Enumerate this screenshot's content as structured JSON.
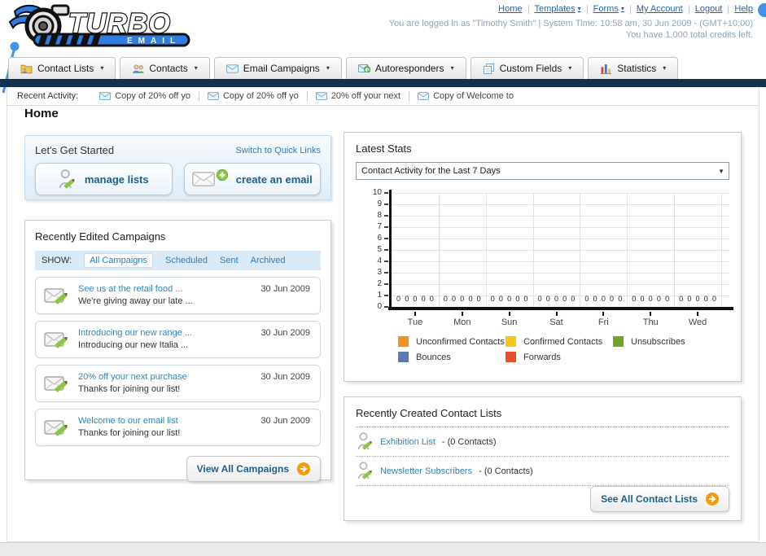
{
  "page_title": "Home",
  "icons": {
    "caret_down": "▾",
    "select_arrow": "▼"
  },
  "header": {
    "brand": {
      "name": "TURBO",
      "sub": "EMAIL"
    },
    "links": [
      {
        "label": "Home"
      },
      {
        "label": "Templates"
      },
      {
        "label": "Forms"
      },
      {
        "label": "My Account"
      },
      {
        "label": "Logout"
      },
      {
        "label": "Help"
      }
    ],
    "login_line": "You are logged in as \"Timothy Smith\" | System Time: 10:58 am, 30 Jun 2009 - (GMT+10:00)",
    "credits_line": "You have 1,000 total credits left."
  },
  "nav": {
    "tabs": [
      {
        "label": "Contact Lists"
      },
      {
        "label": "Contacts"
      },
      {
        "label": "Email Campaigns"
      },
      {
        "label": "Autoresponders"
      },
      {
        "label": "Custom Fields"
      },
      {
        "label": "Statistics"
      }
    ]
  },
  "recent_activity": {
    "label": "Recent Activity:",
    "items": [
      "Copy of 20% off yo",
      "Copy of 20% off yo",
      "20% off your next",
      "Copy of Welcome to"
    ]
  },
  "get_started": {
    "title": "Let's Get Started",
    "switch_link": "Switch to Quick Links",
    "manage_lists_label": "manage lists",
    "create_email_label": "create an email"
  },
  "campaigns": {
    "title": "Recently Edited Campaigns",
    "show_label": "SHOW:",
    "filters": [
      "All Campaigns",
      "Scheduled",
      "Sent",
      "Archived"
    ],
    "active_filter": "All Campaigns",
    "items": [
      {
        "title": "See us at the retail food ...",
        "subtitle": "We're giving away our late ...",
        "date": "30 Jun 2009"
      },
      {
        "title": "Introducing our new range ...",
        "subtitle": "Introducing our new Italia ...",
        "date": "30 Jun 2009"
      },
      {
        "title": "20% off your next purchase",
        "subtitle": "Thanks for joining our list!",
        "date": "30 Jun 2009"
      },
      {
        "title": "Welcome to our email list",
        "subtitle": "Thanks for joining our list!",
        "date": "30 Jun 2009"
      }
    ],
    "view_all_label": "View All Campaigns"
  },
  "stats": {
    "title": "Latest Stats",
    "selected_option": "Contact Activity for the Last 7 Days"
  },
  "chart_data": {
    "type": "bar",
    "title": "Contact Activity for the Last 7 Days",
    "categories": [
      "Tue",
      "Mon",
      "Sun",
      "Sat",
      "Fri",
      "Thu",
      "Wed"
    ],
    "series": [
      {
        "name": "Unconfirmed Contacts",
        "color": "#f5921e",
        "values": [
          0,
          0,
          0,
          0,
          0,
          0,
          0
        ]
      },
      {
        "name": "Confirmed Contacts",
        "color": "#f8c71c",
        "values": [
          0,
          0,
          0,
          0,
          0,
          0,
          0
        ]
      },
      {
        "name": "Unsubscribes",
        "color": "#74a425",
        "values": [
          0,
          0,
          0,
          0,
          0,
          0,
          0
        ]
      },
      {
        "name": "Bounces",
        "color": "#5b79b2",
        "values": [
          0,
          0,
          0,
          0,
          0,
          0,
          0
        ]
      },
      {
        "name": "Forwards",
        "color": "#e8502b",
        "values": [
          0,
          0,
          0,
          0,
          0,
          0,
          0
        ]
      }
    ],
    "ylim": [
      0,
      10
    ],
    "yticks": [
      0,
      1,
      2,
      3,
      4,
      5,
      6,
      7,
      8,
      9,
      10
    ],
    "grid": true,
    "legend_position": "bottom",
    "show_value_labels": true
  },
  "contact_lists": {
    "title": "Recently Created Contact Lists",
    "items": [
      {
        "name": "Exhibition List",
        "detail": "- (0 Contacts)"
      },
      {
        "name": "Newsletter Subscribers",
        "detail": "- (0 Contacts)"
      }
    ],
    "see_all_label": "See All Contact Lists"
  }
}
